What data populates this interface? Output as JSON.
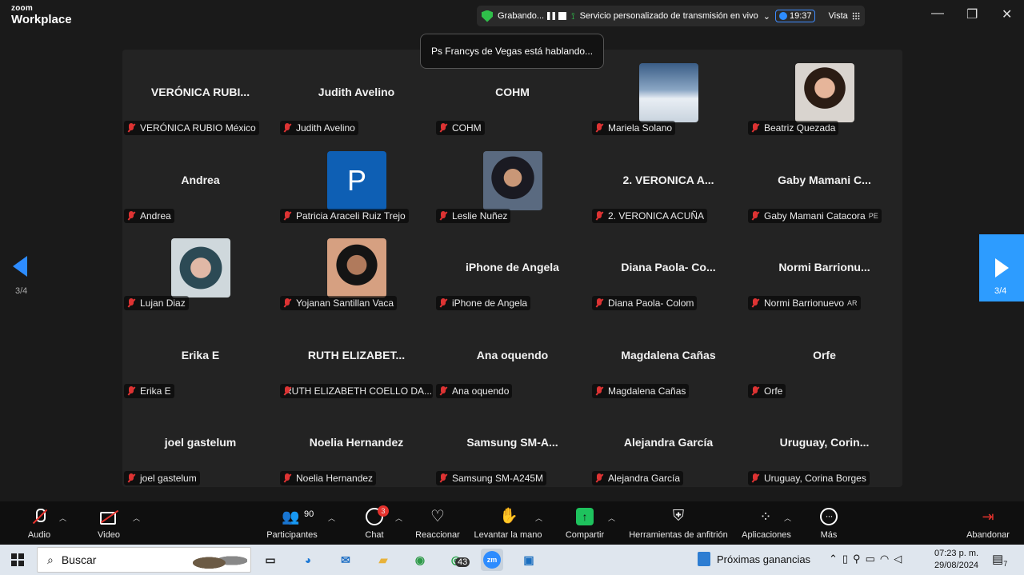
{
  "window": {
    "brand_top": "zoom",
    "brand_bottom": "Workplace",
    "recording_label": "Grabando...",
    "stream_label": "Servicio personalizado de transmisión en vivo",
    "timer": "19:37",
    "view_label": "Vista",
    "minimize": "—",
    "restore": "❐",
    "close": "✕"
  },
  "speaking_banner": "Ps Francys de Vegas está hablando...",
  "pagination": {
    "left": "3/4",
    "right": "3/4"
  },
  "participants": [
    {
      "title": "VERÓNICA RUBI...",
      "name": "VERÓNICA RUBIO México"
    },
    {
      "title": "Judith Avelino",
      "name": "Judith Avelino"
    },
    {
      "title": "COHM",
      "name": "COHM"
    },
    {
      "title": "",
      "name": "Mariela Solano"
    },
    {
      "title": "",
      "name": "Beatriz Quezada"
    },
    {
      "title": "Andrea",
      "name": "Andrea"
    },
    {
      "title": "",
      "name": "Patricia Araceli Ruiz Trejo",
      "letter": "P"
    },
    {
      "title": "",
      "name": "Leslie Nuñez"
    },
    {
      "title": "2. VERONICA A...",
      "name": "2. VERONICA ACUÑA"
    },
    {
      "title": "Gaby Mamani C...",
      "name": "Gaby Mamani Catacora",
      "tag": "PE"
    },
    {
      "title": "",
      "name": "Lujan Diaz"
    },
    {
      "title": "",
      "name": "Yojanan Santillan Vaca"
    },
    {
      "title": "iPhone de Angela",
      "name": "iPhone de Angela"
    },
    {
      "title": "Diana Paola- Co...",
      "name": "Diana Paola- Colom"
    },
    {
      "title": "Normi Barrionu...",
      "name": "Normi Barrionuevo",
      "tag": "AR"
    },
    {
      "title": "Erika E",
      "name": "Erika E"
    },
    {
      "title": "RUTH ELIZABET...",
      "name": "RUTH ELIZABETH COELLO DA..."
    },
    {
      "title": "Ana oquendo",
      "name": "Ana oquendo"
    },
    {
      "title": "Magdalena Cañas",
      "name": "Magdalena Cañas"
    },
    {
      "title": "Orfe",
      "name": "Orfe"
    },
    {
      "title": "joel gastelum",
      "name": "joel gastelum"
    },
    {
      "title": "Noelia Hernandez",
      "name": "Noelia Hernandez"
    },
    {
      "title": "Samsung SM-A...",
      "name": "Samsung SM-A245M"
    },
    {
      "title": "Alejandra García",
      "name": "Alejandra García"
    },
    {
      "title": "Uruguay, Corin...",
      "name": "Uruguay, Corina Borges"
    }
  ],
  "toolbar": {
    "audio": "Audio",
    "video": "Video",
    "participants": "Participantes",
    "participants_count": "90",
    "chat": "Chat",
    "chat_badge": "3",
    "react": "Reaccionar",
    "raise_hand": "Levantar la mano",
    "share": "Compartir",
    "host_tools": "Herramientas de anfitrión",
    "apps": "Aplicaciones",
    "more": "Más",
    "leave": "Abandonar"
  },
  "taskbar": {
    "search_placeholder": "Buscar",
    "whatsapp_badge": "43",
    "zoom_app": "zm",
    "news": "Próximas ganancias",
    "time": "07:23 p. m.",
    "date": "29/08/2024",
    "notifications": "7"
  }
}
